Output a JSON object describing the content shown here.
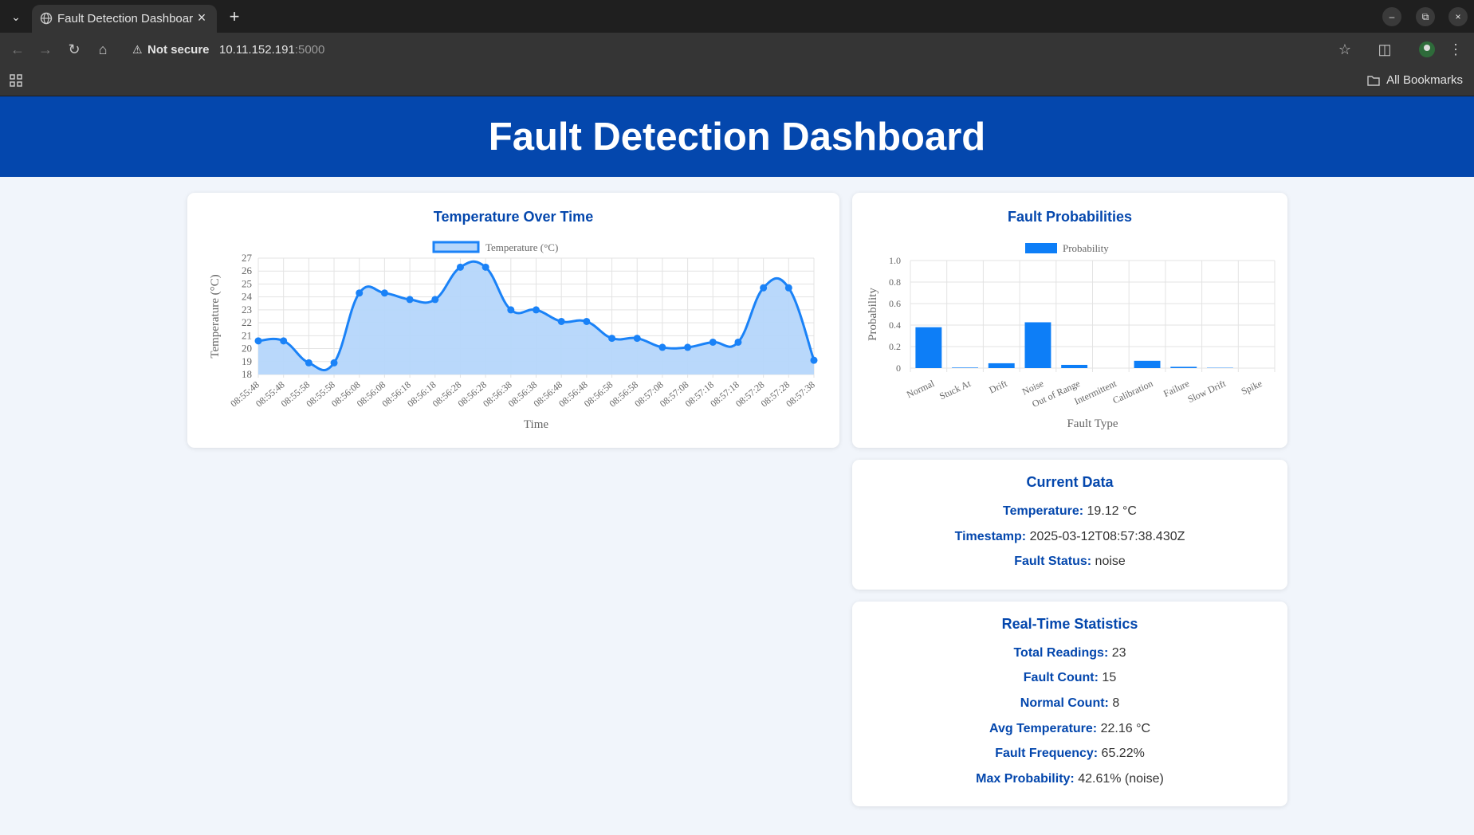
{
  "browser": {
    "tab_title": "Fault Detection Dashboard",
    "security_label": "Not secure",
    "url_host": "10.11.152.191",
    "url_port": ":5000",
    "bookmarks_label": "All Bookmarks"
  },
  "page": {
    "title": "Fault Detection Dashboard"
  },
  "temp_card": {
    "title": "Temperature Over Time"
  },
  "fault_card": {
    "title": "Fault Probabilities"
  },
  "current": {
    "title": "Current Data",
    "temperature_label": "Temperature:",
    "temperature_value": "19.12 °C",
    "timestamp_label": "Timestamp:",
    "timestamp_value": "2025-03-12T08:57:38.430Z",
    "status_label": "Fault Status:",
    "status_value": "noise"
  },
  "stats": {
    "title": "Real-Time Statistics",
    "items": [
      {
        "label": "Total Readings:",
        "value": "23"
      },
      {
        "label": "Fault Count:",
        "value": "15"
      },
      {
        "label": "Normal Count:",
        "value": "8"
      },
      {
        "label": "Avg Temperature:",
        "value": "22.16 °C"
      },
      {
        "label": "Fault Frequency:",
        "value": "65.22%"
      },
      {
        "label": "Max Probability:",
        "value": "42.61% (noise)"
      }
    ]
  },
  "colors": {
    "accent": "#0447ad",
    "chart_line": "#1a82f7",
    "chart_fill": "#b5d6fb",
    "bar": "#0d7ef7"
  },
  "chart_data": [
    {
      "type": "line",
      "title": "Temperature Over Time",
      "legend": [
        "Temperature (°C)"
      ],
      "legend_position": "top",
      "xlabel": "Time",
      "ylabel": "Temperature (°C)",
      "ylim": [
        18,
        27
      ],
      "yticks": [
        18,
        19,
        20,
        21,
        22,
        23,
        24,
        25,
        26,
        27
      ],
      "x": [
        "08:55:48",
        "08:55:48",
        "08:55:58",
        "08:55:58",
        "08:56:08",
        "08:56:08",
        "08:56:18",
        "08:56:18",
        "08:56:28",
        "08:56:28",
        "08:56:38",
        "08:56:38",
        "08:56:48",
        "08:56:48",
        "08:56:58",
        "08:56:58",
        "08:57:08",
        "08:57:08",
        "08:57:18",
        "08:57:18",
        "08:57:28",
        "08:57:28",
        "08:57:38"
      ],
      "series": [
        {
          "name": "Temperature (°C)",
          "values": [
            20.6,
            20.6,
            18.9,
            18.9,
            24.3,
            24.3,
            23.8,
            23.8,
            26.3,
            26.3,
            23.0,
            23.0,
            22.1,
            22.1,
            20.8,
            20.8,
            20.1,
            20.1,
            20.5,
            20.5,
            24.7,
            24.7,
            19.1
          ]
        }
      ],
      "grid": true
    },
    {
      "type": "bar",
      "title": "Fault Probabilities",
      "legend": [
        "Probability"
      ],
      "legend_position": "top",
      "xlabel": "Fault Type",
      "ylabel": "Probability",
      "ylim": [
        0,
        1
      ],
      "yticks": [
        "0",
        "0.2",
        "0.4",
        "0.6",
        "0.8",
        "1.0"
      ],
      "categories": [
        "Normal",
        "Stuck At",
        "Drift",
        "Noise",
        "Out of Range",
        "Intermittent",
        "Calibration",
        "Failure",
        "Slow Drift",
        "Spike"
      ],
      "series": [
        {
          "name": "Probability",
          "values": [
            0.38,
            0.005,
            0.045,
            0.426,
            0.03,
            0.0,
            0.068,
            0.012,
            0.003,
            0.0
          ]
        }
      ],
      "grid": true
    }
  ]
}
